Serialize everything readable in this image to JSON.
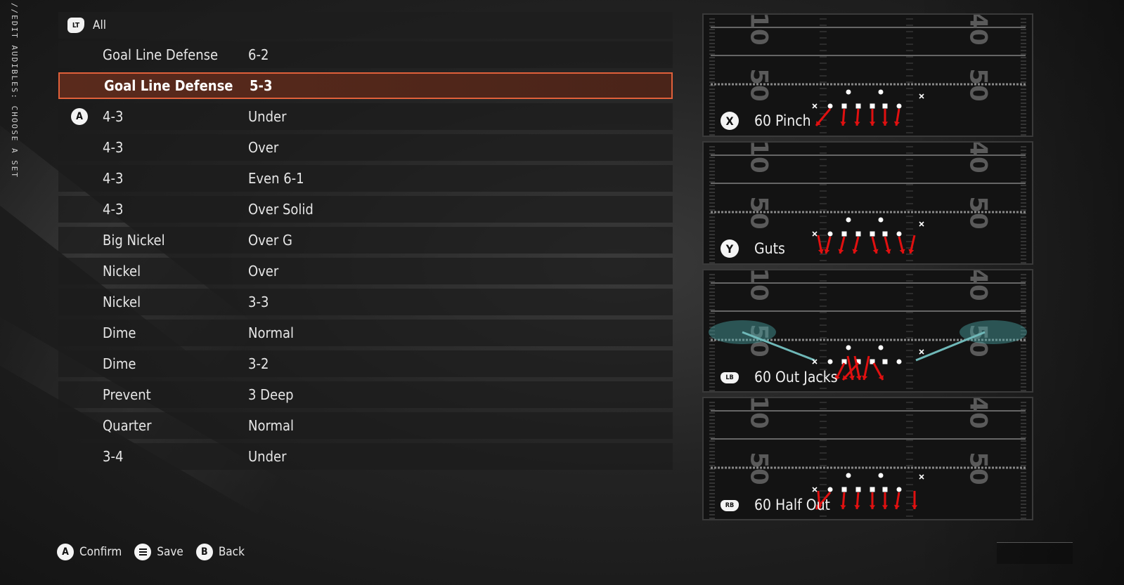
{
  "side_title": "//EDIT AUDIBLES: CHOOSE A SET",
  "filter": {
    "button": "LT",
    "label": "All"
  },
  "formations": [
    {
      "set": "Goal Line Defense",
      "variant": "6-2",
      "selected": false,
      "badge": ""
    },
    {
      "set": "Goal Line Defense",
      "variant": "5-3",
      "selected": true,
      "badge": ""
    },
    {
      "set": "4-3",
      "variant": "Under",
      "selected": false,
      "badge": "A"
    },
    {
      "set": "4-3",
      "variant": "Over",
      "selected": false,
      "badge": ""
    },
    {
      "set": "4-3",
      "variant": "Even 6-1",
      "selected": false,
      "badge": ""
    },
    {
      "set": "4-3",
      "variant": "Over Solid",
      "selected": false,
      "badge": ""
    },
    {
      "set": "Big Nickel",
      "variant": "Over G",
      "selected": false,
      "badge": ""
    },
    {
      "set": "Nickel",
      "variant": "Over",
      "selected": false,
      "badge": ""
    },
    {
      "set": "Nickel",
      "variant": "3-3",
      "selected": false,
      "badge": ""
    },
    {
      "set": "Dime",
      "variant": "Normal",
      "selected": false,
      "badge": ""
    },
    {
      "set": "Dime",
      "variant": "3-2",
      "selected": false,
      "badge": ""
    },
    {
      "set": "Prevent",
      "variant": "3 Deep",
      "selected": false,
      "badge": ""
    },
    {
      "set": "Quarter",
      "variant": "Normal",
      "selected": false,
      "badge": ""
    },
    {
      "set": "3-4",
      "variant": "Under",
      "selected": false,
      "badge": ""
    }
  ],
  "plays": [
    {
      "button": "X",
      "name": "60 Pinch",
      "style": "pinch"
    },
    {
      "button": "Y",
      "name": "Guts",
      "style": "guts"
    },
    {
      "button": "LB",
      "name": "60 Out Jacks",
      "style": "jacks"
    },
    {
      "button": "RB",
      "name": "60 Half Out",
      "style": "half"
    }
  ],
  "field_numbers": {
    "left_top": "10",
    "left_mid": "50",
    "right_top": "40",
    "right_mid": "50"
  },
  "footer": [
    {
      "button": "A",
      "label": "Confirm"
    },
    {
      "button": "menu",
      "label": "Save"
    },
    {
      "button": "B",
      "label": "Back"
    }
  ],
  "colors": {
    "selected_border": "#e0603a",
    "selected_fill": "#5a2a1c",
    "rush_arrow": "#e01010",
    "zone": "#4aa3a3"
  }
}
